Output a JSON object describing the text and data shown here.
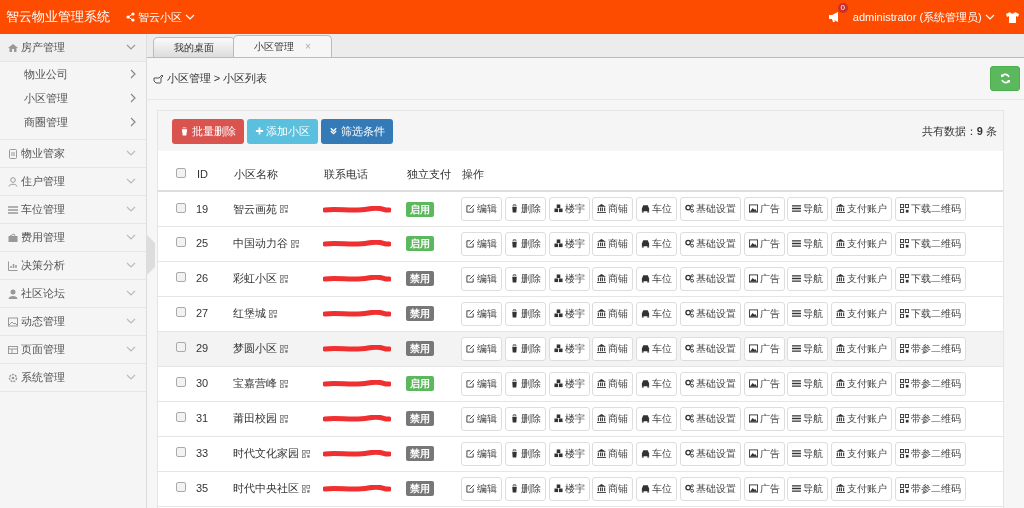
{
  "header": {
    "title": "智云物业管理系统",
    "community": {
      "label": "智云小区",
      "expanded": false
    },
    "notification_count": "0",
    "user": "administrator (系统管理员)"
  },
  "sidebar": {
    "items": [
      {
        "label": "房产管理",
        "expanded": true,
        "children": [
          {
            "label": "物业公司"
          },
          {
            "label": "小区管理"
          },
          {
            "label": "商圈管理"
          }
        ]
      },
      {
        "label": "物业管家",
        "expanded": false
      },
      {
        "label": "住户管理",
        "expanded": false
      },
      {
        "label": "车位管理",
        "expanded": false
      },
      {
        "label": "费用管理",
        "expanded": false
      },
      {
        "label": "决策分析",
        "expanded": false
      },
      {
        "label": "社区论坛",
        "expanded": false
      },
      {
        "label": "动态管理",
        "expanded": false
      },
      {
        "label": "页面管理",
        "expanded": false
      },
      {
        "label": "系统管理",
        "expanded": false
      }
    ]
  },
  "tabs": [
    {
      "label": "我的桌面",
      "selected": false
    },
    {
      "label": "小区管理",
      "selected": true,
      "close": "×"
    }
  ],
  "breadcrumb": "小区管理 > 小区列表",
  "toolbar": {
    "buttons": [
      {
        "label": "批量删除",
        "kind": "danger"
      },
      {
        "label": "添加小区",
        "kind": "info"
      },
      {
        "label": "筛选条件",
        "kind": "primary"
      }
    ],
    "total": "共有数据：**9** 条"
  },
  "table": {
    "select_all_checked": false,
    "columns": [
      "ID",
      "小区名称",
      "联系电话",
      "独立支付",
      "操作"
    ],
    "rows": [
      {
        "id": "19",
        "checked": false,
        "name": "智云画苑",
        "status": "启用",
        "enabled": true,
        "hovered": false,
        "actions": [
          "编辑",
          "删除",
          "楼宇",
          "商铺",
          "车位",
          "基础设置",
          "广告",
          "导航",
          "支付账户",
          "下载二维码"
        ]
      },
      {
        "id": "25",
        "checked": false,
        "name": "中国动力谷",
        "status": "启用",
        "enabled": true,
        "hovered": false,
        "actions": [
          "编辑",
          "删除",
          "楼宇",
          "商铺",
          "车位",
          "基础设置",
          "广告",
          "导航",
          "支付账户",
          "下载二维码"
        ]
      },
      {
        "id": "26",
        "checked": false,
        "name": "彩虹小区",
        "status": "禁用",
        "enabled": false,
        "hovered": false,
        "actions": [
          "编辑",
          "删除",
          "楼宇",
          "商铺",
          "车位",
          "基础设置",
          "广告",
          "导航",
          "支付账户",
          "下载二维码"
        ]
      },
      {
        "id": "27",
        "checked": false,
        "name": "红堡城",
        "status": "禁用",
        "enabled": false,
        "hovered": false,
        "actions": [
          "编辑",
          "删除",
          "楼宇",
          "商铺",
          "车位",
          "基础设置",
          "广告",
          "导航",
          "支付账户",
          "下载二维码"
        ]
      },
      {
        "id": "29",
        "checked": false,
        "name": "梦圆小区",
        "status": "禁用",
        "enabled": false,
        "hovered": true,
        "actions": [
          "编辑",
          "删除",
          "楼宇",
          "商铺",
          "车位",
          "基础设置",
          "广告",
          "导航",
          "支付账户",
          "带参二维码"
        ]
      },
      {
        "id": "30",
        "checked": false,
        "name": "宝嘉营峰",
        "status": "启用",
        "enabled": true,
        "hovered": false,
        "actions": [
          "编辑",
          "删除",
          "楼宇",
          "商铺",
          "车位",
          "基础设置",
          "广告",
          "导航",
          "支付账户",
          "带参二维码"
        ]
      },
      {
        "id": "31",
        "checked": false,
        "name": "莆田校园",
        "status": "禁用",
        "enabled": false,
        "hovered": false,
        "actions": [
          "编辑",
          "删除",
          "楼宇",
          "商铺",
          "车位",
          "基础设置",
          "广告",
          "导航",
          "支付账户",
          "带参二维码"
        ]
      },
      {
        "id": "33",
        "checked": false,
        "name": "时代文化家园",
        "status": "禁用",
        "enabled": false,
        "hovered": false,
        "actions": [
          "编辑",
          "删除",
          "楼宇",
          "商铺",
          "车位",
          "基础设置",
          "广告",
          "导航",
          "支付账户",
          "带参二维码"
        ]
      },
      {
        "id": "35",
        "checked": false,
        "name": "时代中央社区",
        "status": "禁用",
        "enabled": false,
        "hovered": false,
        "actions": [
          "编辑",
          "删除",
          "楼宇",
          "商铺",
          "车位",
          "基础设置",
          "广告",
          "导航",
          "支付账户",
          "带参二维码"
        ]
      }
    ]
  }
}
